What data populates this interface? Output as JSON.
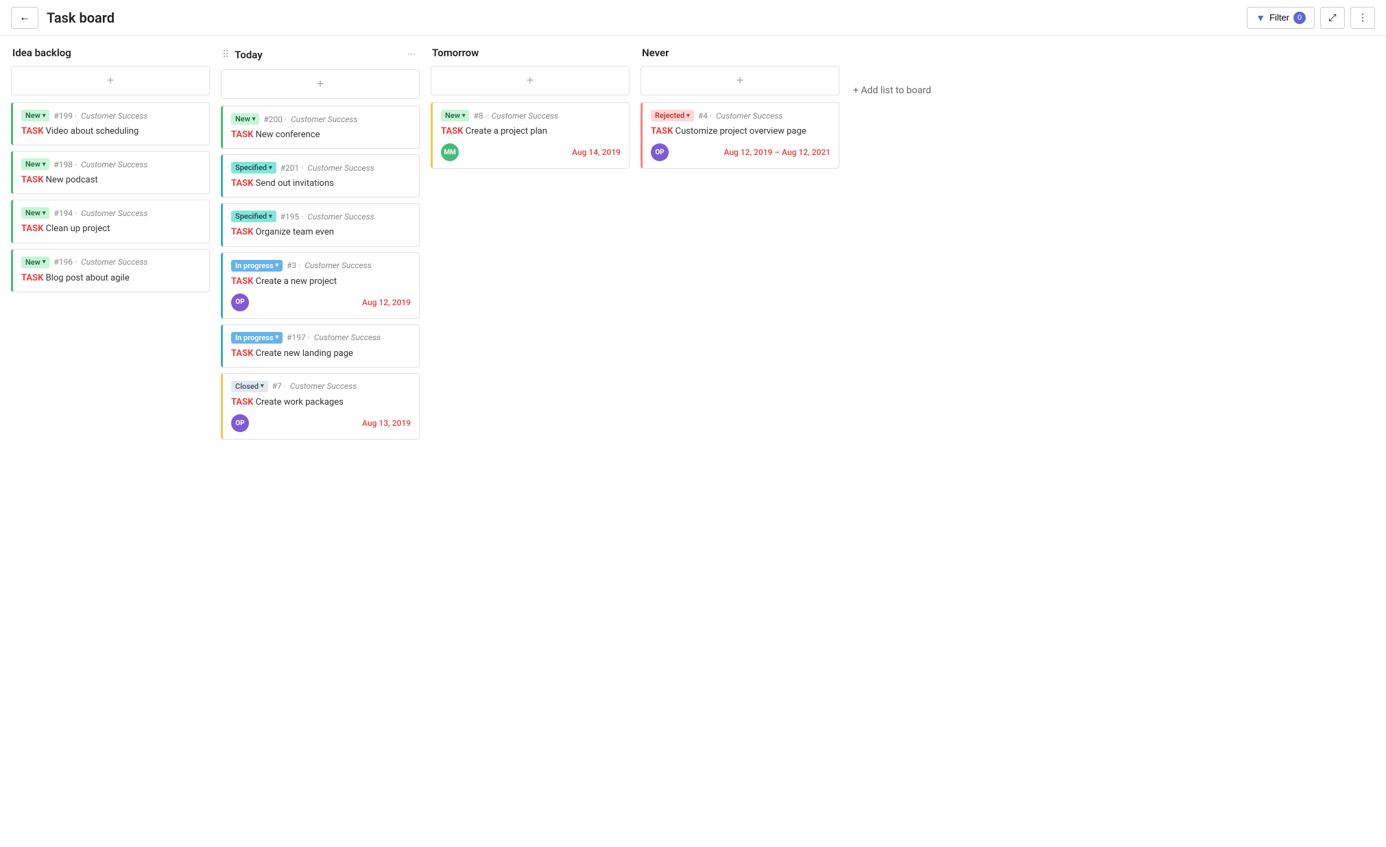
{
  "header": {
    "back_label": "←",
    "title": "Task board",
    "filter_label": "Filter",
    "filter_count": "0",
    "expand_icon": "⤢",
    "more_icon": "⋮"
  },
  "add_list_label": "+ Add list to board",
  "columns": [
    {
      "id": "idea-backlog",
      "title": "Idea backlog",
      "has_drag_handle": false,
      "has_more": false,
      "cards": [
        {
          "id": "c1",
          "border": "border-green",
          "status": "New",
          "status_class": "status-new",
          "number": "#199",
          "project": "Customer Success",
          "task_label": "TASK",
          "title": " Video about scheduling",
          "avatar": null,
          "date": null
        },
        {
          "id": "c2",
          "border": "border-green",
          "status": "New",
          "status_class": "status-new",
          "number": "#198",
          "project": "Customer Success",
          "task_label": "TASK",
          "title": " New podcast",
          "avatar": null,
          "date": null
        },
        {
          "id": "c3",
          "border": "border-green",
          "status": "New",
          "status_class": "status-new",
          "number": "#194",
          "project": "Customer Success",
          "task_label": "TASK",
          "title": " Clean up project",
          "avatar": null,
          "date": null
        },
        {
          "id": "c4",
          "border": "border-green",
          "status": "New",
          "status_class": "status-new",
          "number": "#196",
          "project": "Customer Success",
          "task_label": "TASK",
          "title": " Blog post about agile",
          "avatar": null,
          "date": null
        }
      ]
    },
    {
      "id": "today",
      "title": "Today",
      "has_drag_handle": true,
      "has_more": true,
      "cards": [
        {
          "id": "c5",
          "border": "border-green",
          "status": "New",
          "status_class": "status-new",
          "number": "#200",
          "project": "Customer Success",
          "task_label": "TASK",
          "title": " New conference",
          "avatar": null,
          "date": null
        },
        {
          "id": "c6",
          "border": "border-teal",
          "status": "Specified",
          "status_class": "status-specified",
          "number": "#201",
          "project": "Customer Success",
          "task_label": "TASK",
          "title": " Send out invitations",
          "avatar": null,
          "date": null
        },
        {
          "id": "c7",
          "border": "border-teal",
          "status": "Specified",
          "status_class": "status-specified",
          "number": "#195",
          "project": "Customer Success",
          "task_label": "TASK",
          "title": " Organize team even",
          "avatar": null,
          "date": null
        },
        {
          "id": "c8",
          "border": "border-teal",
          "status": "In progress",
          "status_class": "status-in-progress",
          "number": "#3",
          "project": "Customer Success",
          "task_label": "TASK",
          "title": " Create a new project",
          "avatar": "OP",
          "avatar_class": "avatar-op",
          "date": "Aug 12, 2019"
        },
        {
          "id": "c9",
          "border": "border-teal",
          "status": "In progress",
          "status_class": "status-in-progress",
          "number": "#197",
          "project": "Customer Success",
          "task_label": "TASK",
          "title": " Create new landing page",
          "avatar": null,
          "date": null
        },
        {
          "id": "c10",
          "border": "border-yellow",
          "status": "Closed",
          "status_class": "status-closed",
          "number": "#7",
          "project": "Customer Success",
          "task_label": "TASK",
          "title": " Create work packages",
          "avatar": "OP",
          "avatar_class": "avatar-op",
          "date": "Aug 13, 2019"
        }
      ]
    },
    {
      "id": "tomorrow",
      "title": "Tomorrow",
      "has_drag_handle": false,
      "has_more": false,
      "cards": [
        {
          "id": "c11",
          "border": "border-yellow",
          "status": "New",
          "status_class": "status-new",
          "number": "#8",
          "project": "Customer Success",
          "task_label": "TASK",
          "title": " Create a project plan",
          "avatar": "MM",
          "avatar_class": "avatar-mm",
          "date": "Aug 14, 2019"
        }
      ]
    },
    {
      "id": "never",
      "title": "Never",
      "has_drag_handle": false,
      "has_more": false,
      "cards": [
        {
          "id": "c12",
          "border": "border-red",
          "status": "Rejected",
          "status_class": "status-rejected",
          "number": "#4",
          "project": "Customer Success",
          "task_label": "TASK",
          "title": " Customize project overview page",
          "avatar": "OP",
          "avatar_class": "avatar-op",
          "date": "Aug 12, 2019 – Aug 12, 2021"
        }
      ]
    }
  ]
}
